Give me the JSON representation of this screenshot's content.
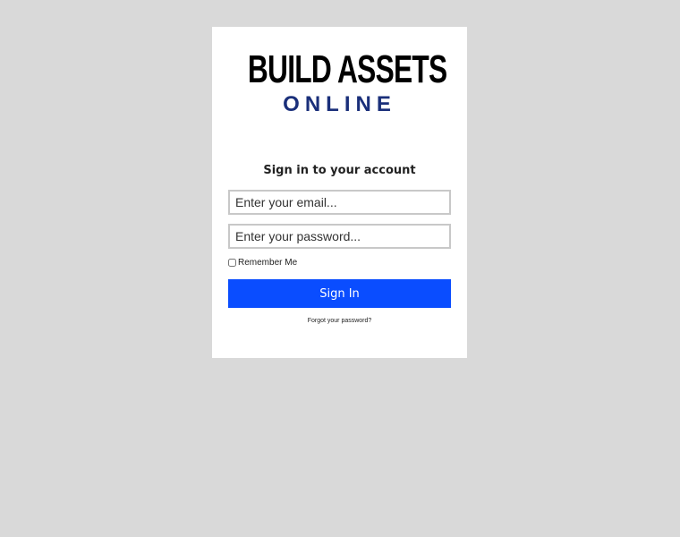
{
  "logo": {
    "line1": "BUILD ASSETS",
    "line2": "ONLINE"
  },
  "form": {
    "heading": "Sign in to your account",
    "email_placeholder": "Enter your email...",
    "password_placeholder": "Enter your password...",
    "remember_label": "Remember Me",
    "remember_checked": false,
    "submit_label": "Sign In",
    "forgot_link": "Forgot your password?"
  },
  "colors": {
    "background": "#d9d9d9",
    "card": "#ffffff",
    "button": "#0a4dff",
    "logo_secondary": "#1a2f7a"
  }
}
